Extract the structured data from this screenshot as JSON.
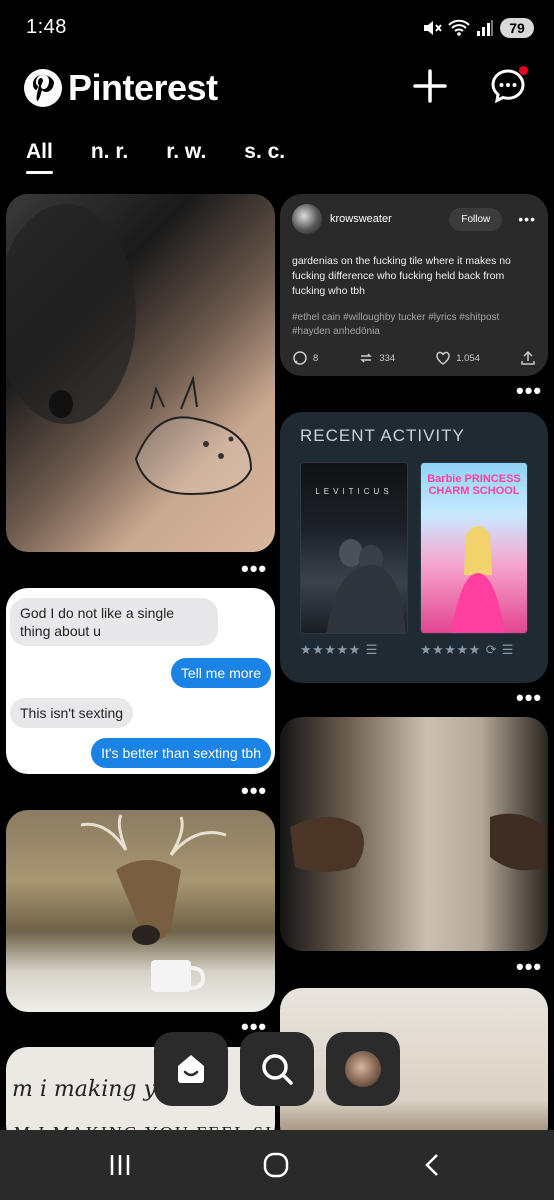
{
  "status_bar": {
    "time": "1:48",
    "battery": "79",
    "signal_label": "5"
  },
  "header": {
    "app_name": "Pinterest",
    "create_icon": "plus-icon",
    "messages_icon": "chat-icon"
  },
  "tabs": [
    {
      "label": "All",
      "active": true
    },
    {
      "label": "n. r.",
      "active": false
    },
    {
      "label": "r. w.",
      "active": false
    },
    {
      "label": "s. c.",
      "active": false
    }
  ],
  "pins": {
    "tumblr": {
      "username": "krowsweater",
      "follow_label": "Follow",
      "body": "gardenias on the fucking tile where it makes no fucking difference who fucking held back from fucking who tbh",
      "tags": "#ethel cain  #willoughby tucker  #lyrics  #shitpost  #hayden anhedönia",
      "comments": "8",
      "reblogs": "334",
      "likes": "1.054"
    },
    "recent_activity": {
      "title": "RECENT ACTIVITY",
      "poster1_title": "LEVITICUS",
      "poster2_title": "Barbie PRINCESS CHARM SCHOOL",
      "rating1": "★★★★★",
      "rating2": "★★★★★"
    },
    "chat": {
      "msg1": "God I do not like a single thing about u",
      "msg2": "Tell me more",
      "msg3": "This isn't sexting",
      "msg4": "It's better than sexting tbh"
    },
    "text_pin": {
      "script_line": "m i making y",
      "caps_line": "M I MAKING YOU FEEL SI"
    },
    "more_label": "•••"
  },
  "colors": {
    "accent_red": "#e60023",
    "bubble_blue": "#1b82e6",
    "recent_bg": "#1f2a33"
  }
}
